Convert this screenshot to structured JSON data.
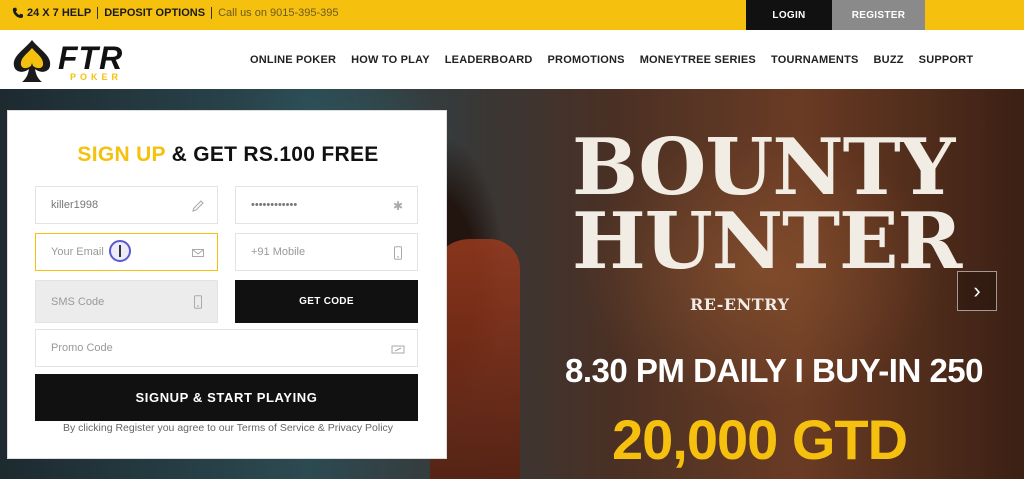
{
  "topbar": {
    "help": "24 X 7 HELP",
    "deposit": "DEPOSIT OPTIONS",
    "call": "Call us on 9015-395-395",
    "login": "LOGIN",
    "register": "REGISTER"
  },
  "logo": {
    "brand": "FTR",
    "sub": "POKER"
  },
  "nav": [
    "ONLINE POKER",
    "HOW TO PLAY",
    "LEADERBOARD",
    "PROMOTIONS",
    "MONEYTREE SERIES",
    "TOURNAMENTS",
    "BUZZ",
    "SUPPORT"
  ],
  "signup": {
    "title_highlight": "SIGN UP",
    "title_rest": " & GET RS.100 FREE",
    "username_value": "killer1998",
    "password_value": "••••••••••••",
    "email_placeholder": "Your Email",
    "mobile_placeholder": "+91 Mobile",
    "sms_placeholder": "SMS Code",
    "get_code": "GET CODE",
    "promo_placeholder": "Promo Code",
    "submit": "SIGNUP & START PLAYING",
    "terms": "By clicking Register you agree to our Terms of Service & Privacy Policy"
  },
  "hero": {
    "line1": "BOUNTY",
    "line2": "HUNTER",
    "subtitle": "RE-ENTRY",
    "schedule": "8.30 PM DAILY I BUY-IN 250",
    "guarantee": "20,000 GTD",
    "next_arrow": "›"
  },
  "colors": {
    "accent": "#f6c10e",
    "dark": "#111111"
  }
}
